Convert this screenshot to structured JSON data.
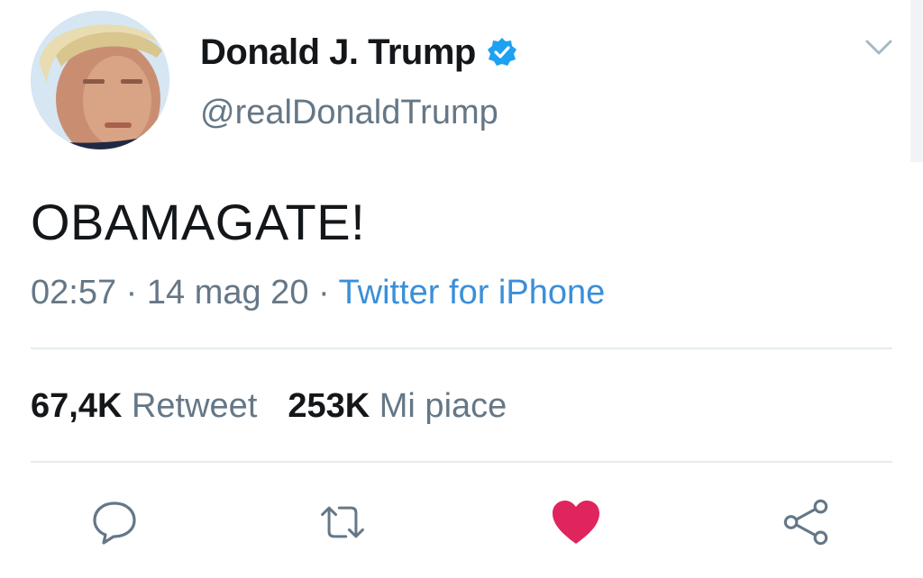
{
  "tweet": {
    "display_name": "Donald J. Trump",
    "handle": "@realDonaldTrump",
    "text": "OBAMAGATE!",
    "time": "02:57",
    "date": "14 mag 20",
    "separator": " · ",
    "source": "Twitter for iPhone"
  },
  "stats": {
    "retweets_count": "67,4K",
    "retweets_label": "Retweet",
    "likes_count": "253K",
    "likes_label": "Mi piace"
  },
  "icons": {
    "verified": "verified-badge-icon",
    "menu": "chevron-down-icon",
    "reply": "reply-icon",
    "retweet": "retweet-icon",
    "like": "heart-icon",
    "share": "share-icon"
  },
  "colors": {
    "verified": "#1da1f2",
    "source_link": "#3a8fd9",
    "like_active": "#e0245e",
    "muted": "#657786",
    "text": "#14171a"
  }
}
